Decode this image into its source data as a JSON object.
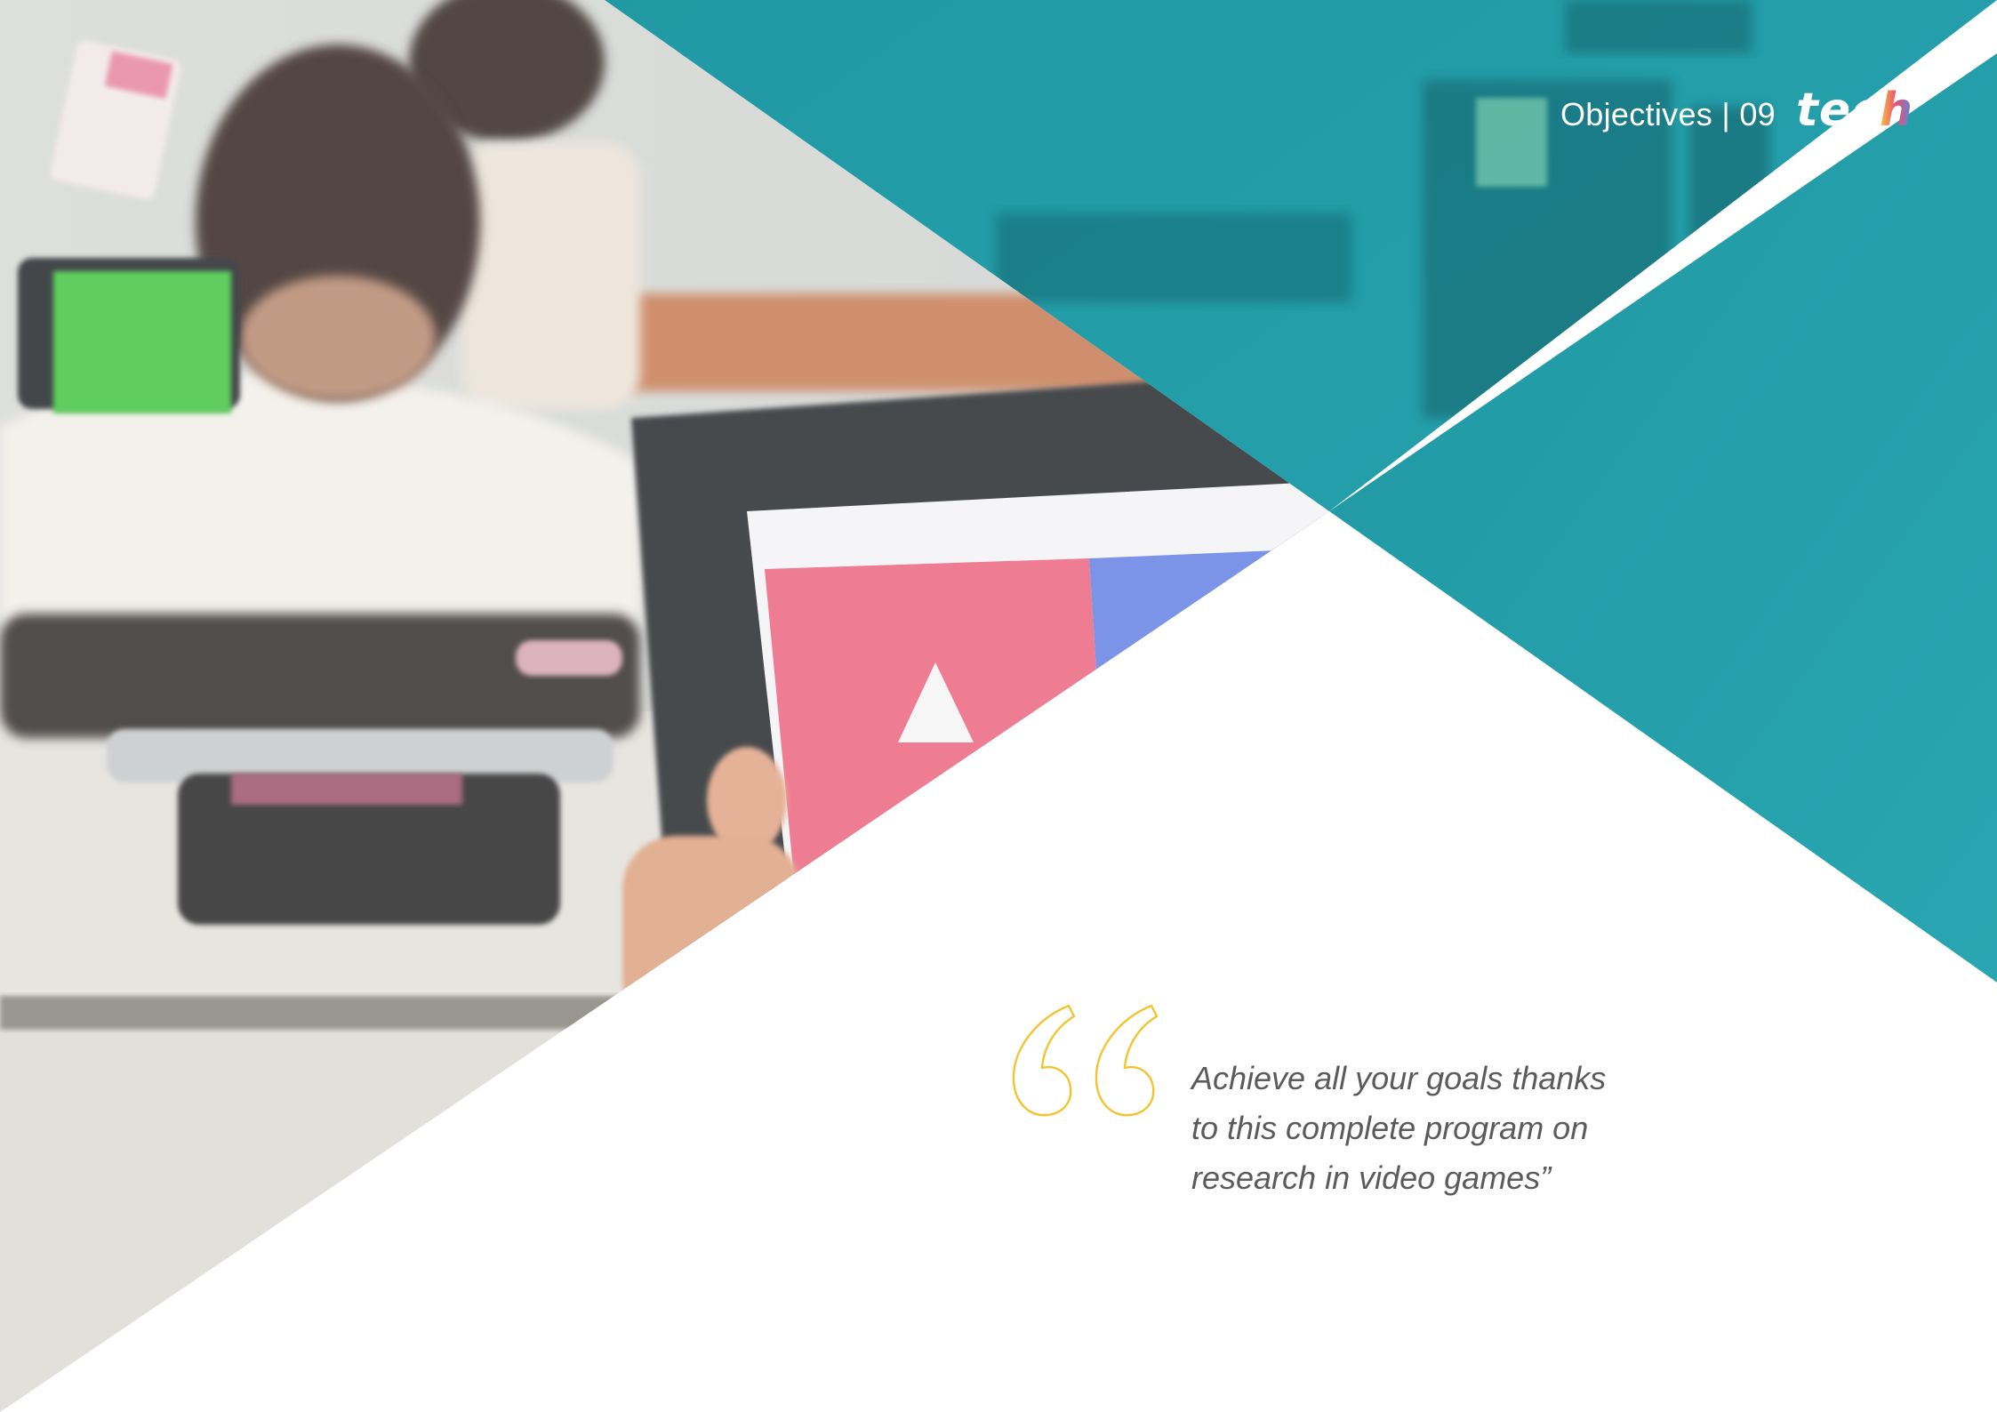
{
  "header": {
    "section_label": "Objectives | 09",
    "logo_main": "tec",
    "logo_last": "h"
  },
  "quote": {
    "text": "Achieve all your goals thanks to this complete program on research in video games”",
    "icon": "quote-open-icon"
  },
  "photo": {
    "description": "classroom-tablet-photo"
  },
  "colors": {
    "teal": "#24a0ab",
    "teal_dark": "#1c8a94",
    "quote_gold": "#f4c430",
    "quote_text": "#5b5b5b",
    "white": "#ffffff"
  }
}
